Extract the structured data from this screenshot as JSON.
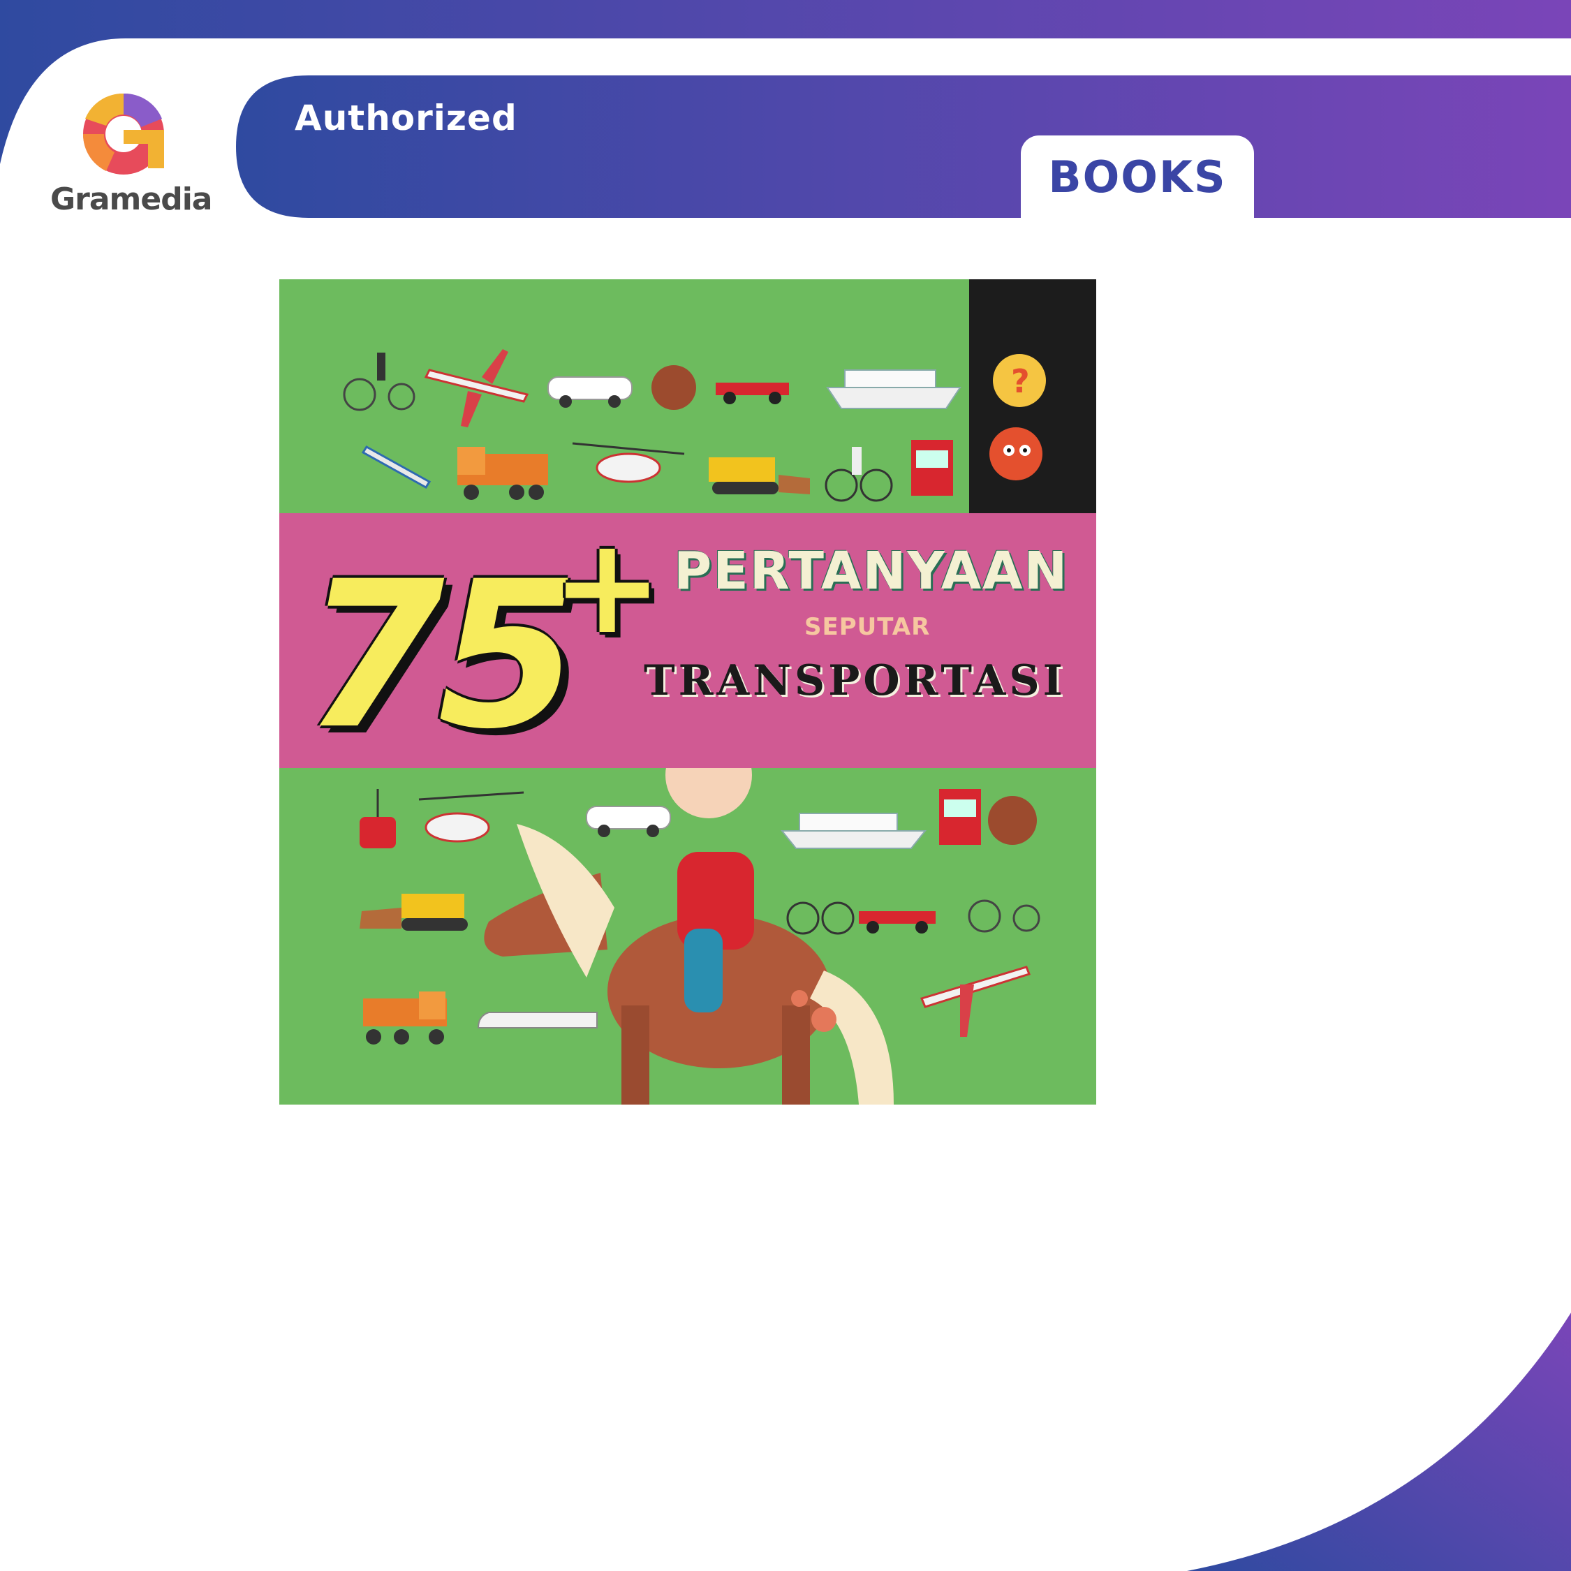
{
  "header": {
    "authorized_label": "Authorized",
    "books_tab_label": "BOOKS",
    "logo_text": "Gramedia"
  },
  "cover": {
    "number_text": "75",
    "plus_text": "+",
    "title_line1": "PERTANYAAN",
    "title_line2": "SEPUTAR",
    "title_line3": "TRANSPORTASI"
  },
  "colors": {
    "brand_blue": "#2f4aa0",
    "brand_purple": "#7a45b8",
    "cover_green": "#6dbb5e",
    "cover_pink": "#d05a93",
    "number_yellow": "#f7ec5d"
  }
}
